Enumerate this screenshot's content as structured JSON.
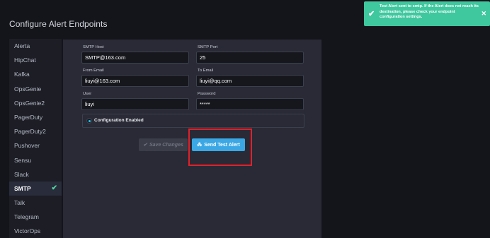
{
  "page": {
    "title": "Configure Alert Endpoints"
  },
  "sidebar": {
    "items": [
      {
        "label": "Alerta"
      },
      {
        "label": "HipChat"
      },
      {
        "label": "Kafka"
      },
      {
        "label": "OpsGenie"
      },
      {
        "label": "OpsGenie2"
      },
      {
        "label": "PagerDuty"
      },
      {
        "label": "PagerDuty2"
      },
      {
        "label": "Pushover"
      },
      {
        "label": "Sensu"
      },
      {
        "label": "Slack"
      },
      {
        "label": "SMTP",
        "active": true
      },
      {
        "label": "Talk"
      },
      {
        "label": "Telegram"
      },
      {
        "label": "VictorOps"
      }
    ],
    "active_check": "✔"
  },
  "form": {
    "smtp_host": {
      "label": "SMTP Host",
      "value": "SMTP@163.com"
    },
    "smtp_port": {
      "label": "SMTP Port",
      "value": "25"
    },
    "from_email": {
      "label": "From Email",
      "value": "liuyi@163.com"
    },
    "to_email": {
      "label": "To Email",
      "value": "liuyi@qq.com"
    },
    "user": {
      "label": "User",
      "value": "liuyi"
    },
    "password": {
      "label": "Password",
      "value": "*****"
    },
    "config_enabled": {
      "label": "Configuration Enabled",
      "checked": true
    }
  },
  "buttons": {
    "save_label": "Save Changes",
    "save_icon": "✔",
    "test_label": "Send Test Alert",
    "test_icon": "⁂"
  },
  "toast": {
    "message": "Test Alert sent to smtp. If the Alert does not reach its destination, please check your endpoint configuration settings.",
    "check_icon": "✔",
    "close_icon": "✕"
  },
  "colors": {
    "accent": "#3ba8e5",
    "success": "#3fc79e",
    "highlight": "#e0212a"
  }
}
